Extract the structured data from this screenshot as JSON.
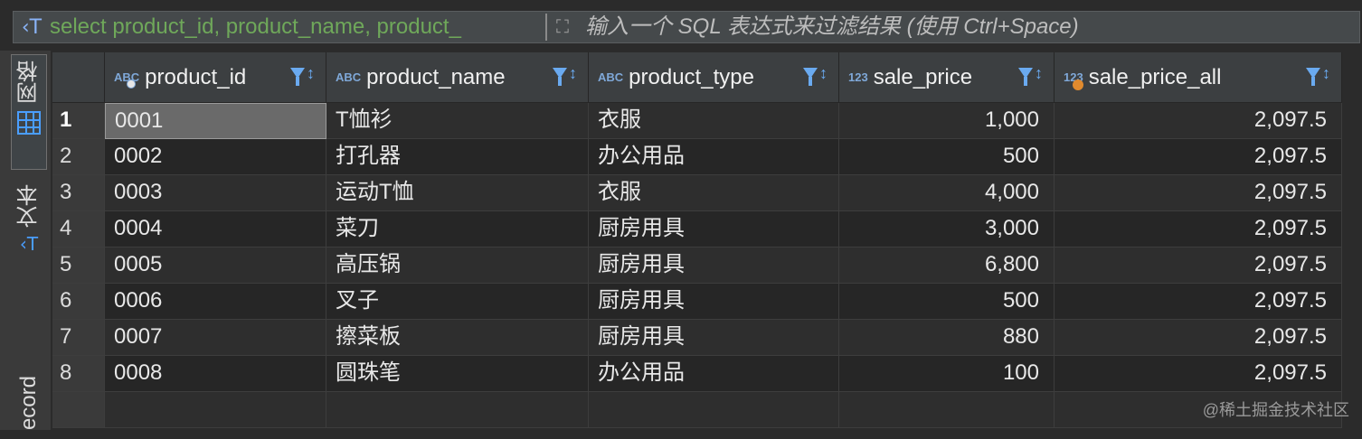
{
  "filter": {
    "icon": "text-filter-icon",
    "sql_text": "select product_id, product_name, product_",
    "placeholder": "输入一个 SQL 表达式来过滤结果 (使用 Ctrl+Space)"
  },
  "side_tabs": {
    "grid_label": "网格",
    "text_label": "文本",
    "record_label": "ecord"
  },
  "columns": [
    {
      "badge": "ABC",
      "label": "product_id",
      "marker": "key"
    },
    {
      "badge": "ABC",
      "label": "product_name",
      "marker": ""
    },
    {
      "badge": "ABC",
      "label": "product_type",
      "marker": ""
    },
    {
      "badge": "123",
      "label": "sale_price",
      "marker": ""
    },
    {
      "badge": "123",
      "label": "sale_price_all",
      "marker": "dot"
    }
  ],
  "rows": [
    {
      "n": "1",
      "id": "0001",
      "name": "T恤衫",
      "type": "衣服",
      "price": "1,000",
      "all": "2,097.5"
    },
    {
      "n": "2",
      "id": "0002",
      "name": "打孔器",
      "type": "办公用品",
      "price": "500",
      "all": "2,097.5"
    },
    {
      "n": "3",
      "id": "0003",
      "name": "运动T恤",
      "type": "衣服",
      "price": "4,000",
      "all": "2,097.5"
    },
    {
      "n": "4",
      "id": "0004",
      "name": "菜刀",
      "type": "厨房用具",
      "price": "3,000",
      "all": "2,097.5"
    },
    {
      "n": "5",
      "id": "0005",
      "name": "高压锅",
      "type": "厨房用具",
      "price": "6,800",
      "all": "2,097.5"
    },
    {
      "n": "6",
      "id": "0006",
      "name": "叉子",
      "type": "厨房用具",
      "price": "500",
      "all": "2,097.5"
    },
    {
      "n": "7",
      "id": "0007",
      "name": "擦菜板",
      "type": "厨房用具",
      "price": "880",
      "all": "2,097.5"
    },
    {
      "n": "8",
      "id": "0008",
      "name": "圆珠笔",
      "type": "办公用品",
      "price": "100",
      "all": "2,097.5"
    }
  ],
  "watermark": "@稀土掘金技术社区"
}
